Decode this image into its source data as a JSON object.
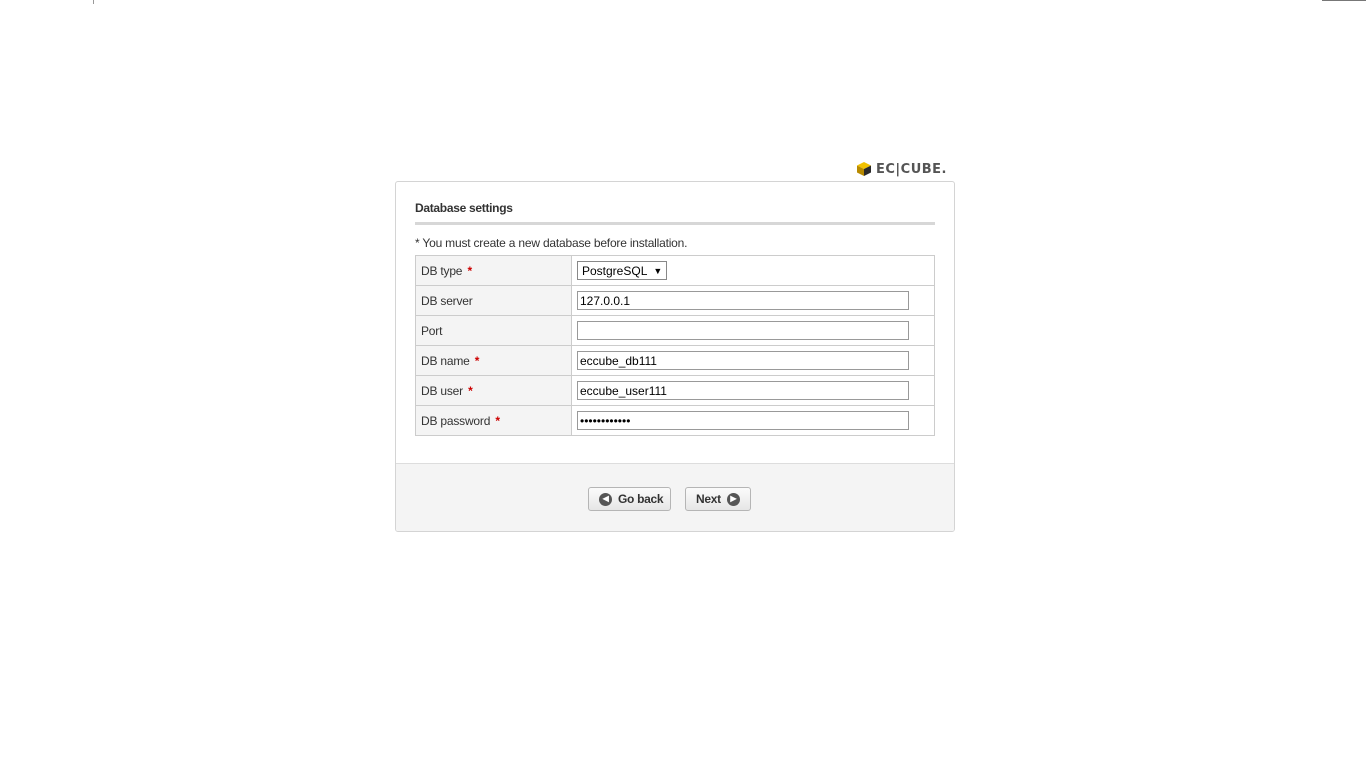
{
  "logo": {
    "text": "EC|CUBE.",
    "accent_color": "#d9a400"
  },
  "panel": {
    "title": "Database settings",
    "notice": "* You must create a new database before installation."
  },
  "form": {
    "db_type": {
      "label": "DB type",
      "required_mark": "*",
      "selected": "PostgreSQL"
    },
    "db_server": {
      "label": "DB server",
      "value": "127.0.0.1"
    },
    "port": {
      "label": "Port",
      "value": ""
    },
    "db_name": {
      "label": "DB name",
      "required_mark": "*",
      "value": "eccube_db111"
    },
    "db_user": {
      "label": "DB user",
      "required_mark": "*",
      "value": "eccube_user111"
    },
    "db_password": {
      "label": "DB password",
      "required_mark": "*",
      "value": "••••••••••••"
    }
  },
  "buttons": {
    "back_label": "Go back",
    "next_label": "Next"
  },
  "colors": {
    "required": "#cc0000",
    "label_bg": "#f4f4f4",
    "footer_bg": "#f4f4f4"
  }
}
